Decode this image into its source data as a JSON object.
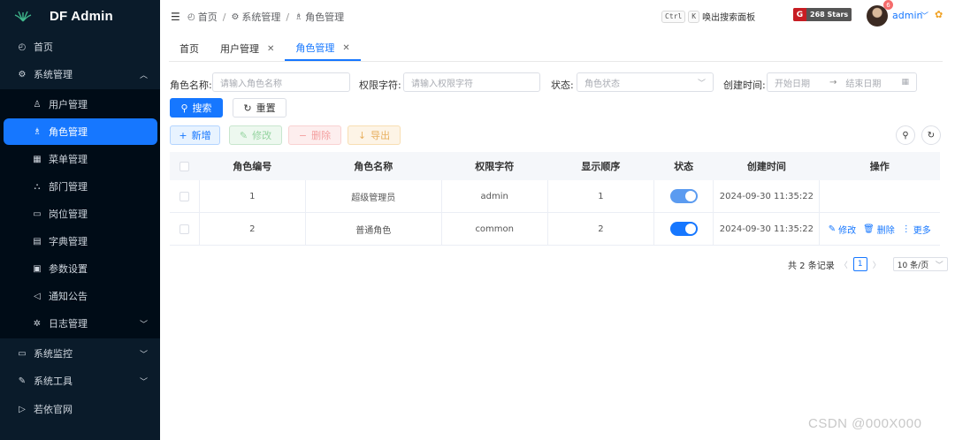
{
  "app": {
    "title": "DF Admin"
  },
  "sidebar": {
    "items": [
      {
        "label": "首页",
        "icon": "dashboard-icon"
      },
      {
        "label": "系统管理",
        "icon": "gear-icon",
        "expanded": true
      },
      {
        "label": "用户管理",
        "icon": "user-icon"
      },
      {
        "label": "角色管理",
        "icon": "users-icon",
        "active": true
      },
      {
        "label": "菜单管理",
        "icon": "menu-icon"
      },
      {
        "label": "部门管理",
        "icon": "tree-icon"
      },
      {
        "label": "岗位管理",
        "icon": "post-icon"
      },
      {
        "label": "字典管理",
        "icon": "book-icon"
      },
      {
        "label": "参数设置",
        "icon": "settings-icon"
      },
      {
        "label": "通知公告",
        "icon": "megaphone-icon"
      },
      {
        "label": "日志管理",
        "icon": "log-icon"
      },
      {
        "label": "系统监控",
        "icon": "monitor-icon"
      },
      {
        "label": "系统工具",
        "icon": "tool-icon"
      },
      {
        "label": "若依官网",
        "icon": "send-icon"
      }
    ]
  },
  "header": {
    "breadcrumb": [
      "首页",
      "系统管理",
      "角色管理"
    ],
    "kbd_ctrl": "Ctrl",
    "kbd_k": "K",
    "search_hint": "唤出搜索面板",
    "stars": "268 Stars",
    "notification_count": "6",
    "user_name": "admin"
  },
  "tabs": [
    {
      "label": "首页"
    },
    {
      "label": "用户管理"
    },
    {
      "label": "角色管理",
      "active": true
    }
  ],
  "search": {
    "role_name_label": "角色名称:",
    "role_name_placeholder": "请输入角色名称",
    "role_key_label": "权限字符:",
    "role_key_placeholder": "请输入权限字符",
    "status_label": "状态:",
    "status_placeholder": "角色状态",
    "created_label": "创建时间:",
    "start_placeholder": "开始日期",
    "end_placeholder": "结束日期",
    "search_button": "搜索",
    "reset_button": "重置"
  },
  "toolbar": {
    "add": "新增",
    "edit": "修改",
    "delete": "删除",
    "export": "导出"
  },
  "table": {
    "headers": [
      "角色编号",
      "角色名称",
      "权限字符",
      "显示顺序",
      "状态",
      "创建时间",
      "操作"
    ],
    "rows": [
      {
        "id": "1",
        "name": "超级管理员",
        "key": "admin",
        "order": "1",
        "enabled": true,
        "created": "2024-09-30 11:35:22"
      },
      {
        "id": "2",
        "name": "普通角色",
        "key": "common",
        "order": "2",
        "enabled": true,
        "created": "2024-09-30 11:35:22",
        "ops": {
          "edit": "修改",
          "delete": "删除",
          "more": "更多"
        }
      }
    ]
  },
  "pagination": {
    "total": "共 2 条记录",
    "current": "1",
    "page_size": "10 条/页"
  },
  "watermark": "CSDN @000X000",
  "colors": {
    "primary": "#1677ff",
    "sidebar": "#0a1b2a"
  }
}
